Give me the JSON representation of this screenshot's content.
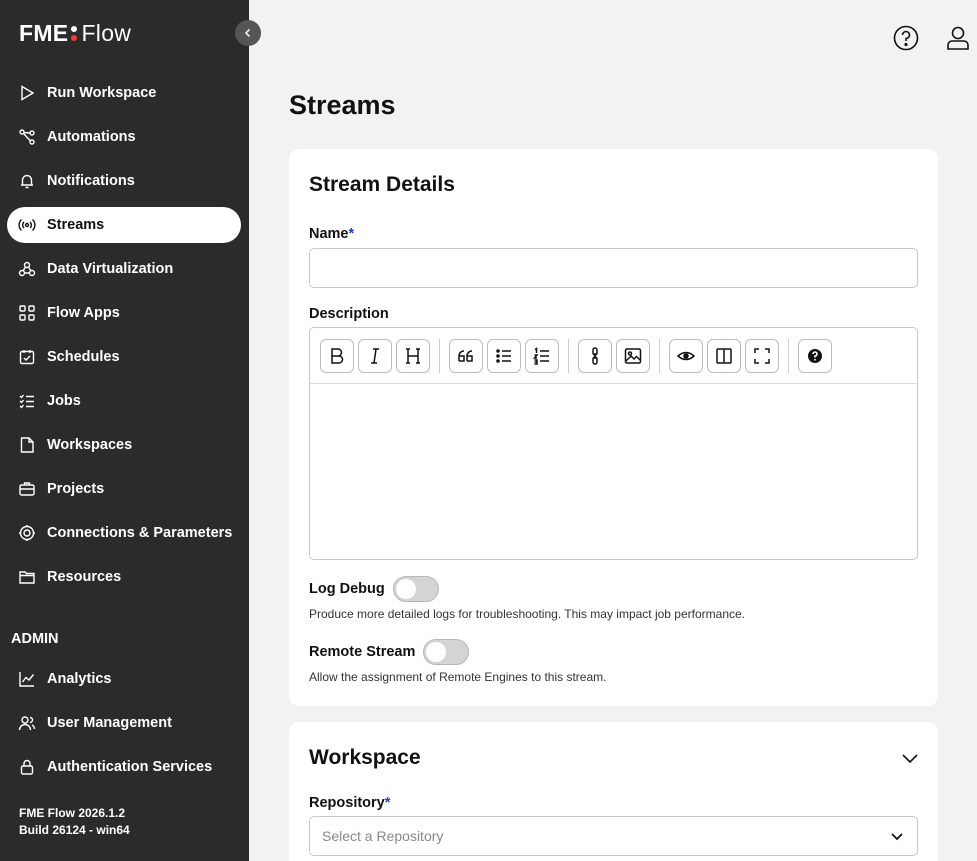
{
  "logo": {
    "fme": "FME",
    "flow": "Flow",
    "dot_colors": [
      "#ffffff",
      "#e8433a"
    ]
  },
  "nav": {
    "items": [
      {
        "label": "Run Workspace",
        "icon": "play-icon"
      },
      {
        "label": "Automations",
        "icon": "automations-icon"
      },
      {
        "label": "Notifications",
        "icon": "bell-icon"
      },
      {
        "label": "Streams",
        "icon": "broadcast-icon",
        "active": true
      },
      {
        "label": "Data Virtualization",
        "icon": "data-virtualization-icon"
      },
      {
        "label": "Flow Apps",
        "icon": "apps-icon"
      },
      {
        "label": "Schedules",
        "icon": "calendar-icon"
      },
      {
        "label": "Jobs",
        "icon": "jobs-list-icon"
      },
      {
        "label": "Workspaces",
        "icon": "file-icon"
      },
      {
        "label": "Projects",
        "icon": "briefcase-icon"
      },
      {
        "label": "Connections & Parameters",
        "icon": "connections-icon"
      },
      {
        "label": "Resources",
        "icon": "folder-icon"
      }
    ],
    "admin_label": "ADMIN",
    "admin_items": [
      {
        "label": "Analytics",
        "icon": "analytics-icon"
      },
      {
        "label": "User Management",
        "icon": "users-icon"
      },
      {
        "label": "Authentication Services",
        "icon": "lock-icon"
      }
    ],
    "version": "FME Flow 2026.1.2",
    "build": "Build 26124 - win64"
  },
  "page": {
    "title": "Streams"
  },
  "details": {
    "title": "Stream Details",
    "name_label": "Name",
    "required_mark": "*",
    "name_value": "",
    "description_label": "Description",
    "log_debug_label": "Log Debug",
    "log_debug_on": false,
    "log_debug_help": "Produce more detailed logs for troubleshooting. This may impact job performance.",
    "remote_stream_label": "Remote Stream",
    "remote_stream_on": false,
    "remote_stream_help": "Allow the assignment of Remote Engines to this stream."
  },
  "workspace": {
    "title": "Workspace",
    "repository_label": "Repository",
    "repository_placeholder": "Select a Repository"
  }
}
